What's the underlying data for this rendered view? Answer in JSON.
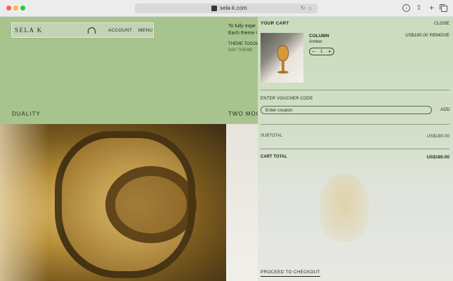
{
  "browser": {
    "url": "sela-k.com"
  },
  "nav": {
    "logo": "SELA K",
    "account": "ACCOUNT",
    "menu": "MENU"
  },
  "hero": {
    "intro_line1": "To fully expe",
    "intro_line2": "Each theme i",
    "theme_toggle": "THEME TOGGLE",
    "day_theme": "DAY THEME",
    "section_left": "DUALITY",
    "section_right": "TWO MOODS"
  },
  "cart": {
    "title": "YOUR CART",
    "close": "CLOSE",
    "item": {
      "name": "COLUMN",
      "variant": "Amber",
      "quantity": "1",
      "price": "US$180.00",
      "remove": "REMOVE"
    },
    "voucher_label": "ENTER VOUCHER CODE",
    "coupon_placeholder": "Enter coupon",
    "add": "ADD",
    "subtotal_label": "SUBTOTAL",
    "subtotal_value": "US$180.00",
    "total_label": "CART TOTAL",
    "total_value": "US$180.00",
    "checkout": "PROCEED TO CHECKOUT"
  },
  "colors": {
    "hero_green": "#a8c48e",
    "cart_green": "#cbdcbd",
    "text_dark": "#1e2a1a"
  },
  "icons": [
    "download-icon",
    "share-icon",
    "new-tab-icon",
    "tabs-overview-icon",
    "reload-icon",
    "extension-icon",
    "arch-icon",
    "minus-icon",
    "plus-icon"
  ]
}
